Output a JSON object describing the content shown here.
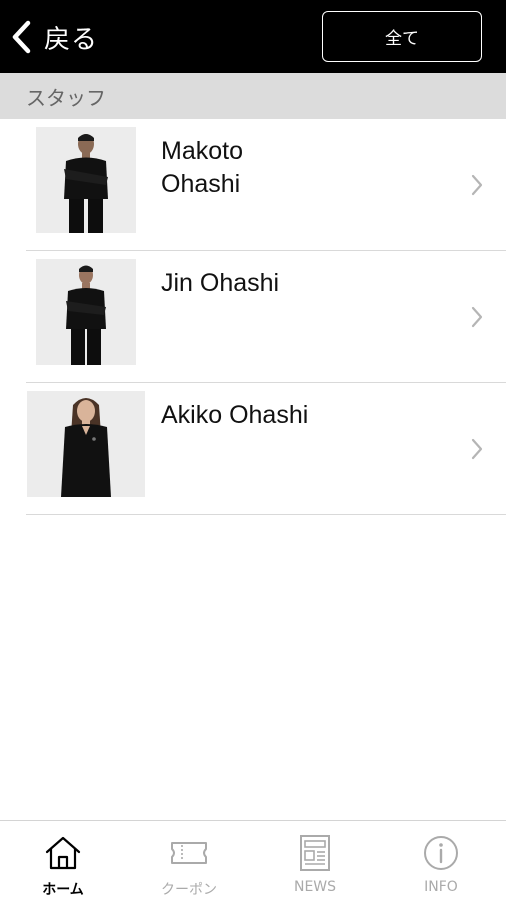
{
  "header": {
    "back_label": "戻る",
    "all_button_label": "全て"
  },
  "section": {
    "title": "スタッフ"
  },
  "staff": [
    {
      "name_line1": "Makoto",
      "name_line2": "Ohashi",
      "photo": "man-black-uniform-photo"
    },
    {
      "name_line1": "Jin Ohashi",
      "name_line2": "",
      "photo": "man-black-uniform-photo"
    },
    {
      "name_line1": "Akiko Ohashi",
      "name_line2": "",
      "photo": "woman-black-uniform-photo"
    }
  ],
  "tabbar": {
    "tabs": [
      {
        "label": "ホーム",
        "icon": "home-icon",
        "active": true
      },
      {
        "label": "クーポン",
        "icon": "ticket-icon",
        "active": false
      },
      {
        "label": "NEWS",
        "icon": "newspaper-icon",
        "active": false
      },
      {
        "label": "INFO",
        "icon": "info-icon",
        "active": false
      }
    ]
  },
  "colors": {
    "header_bg": "#000000",
    "section_bg": "#dcdcdc",
    "tab_inactive": "#aaaaaa",
    "tab_active": "#000000"
  }
}
